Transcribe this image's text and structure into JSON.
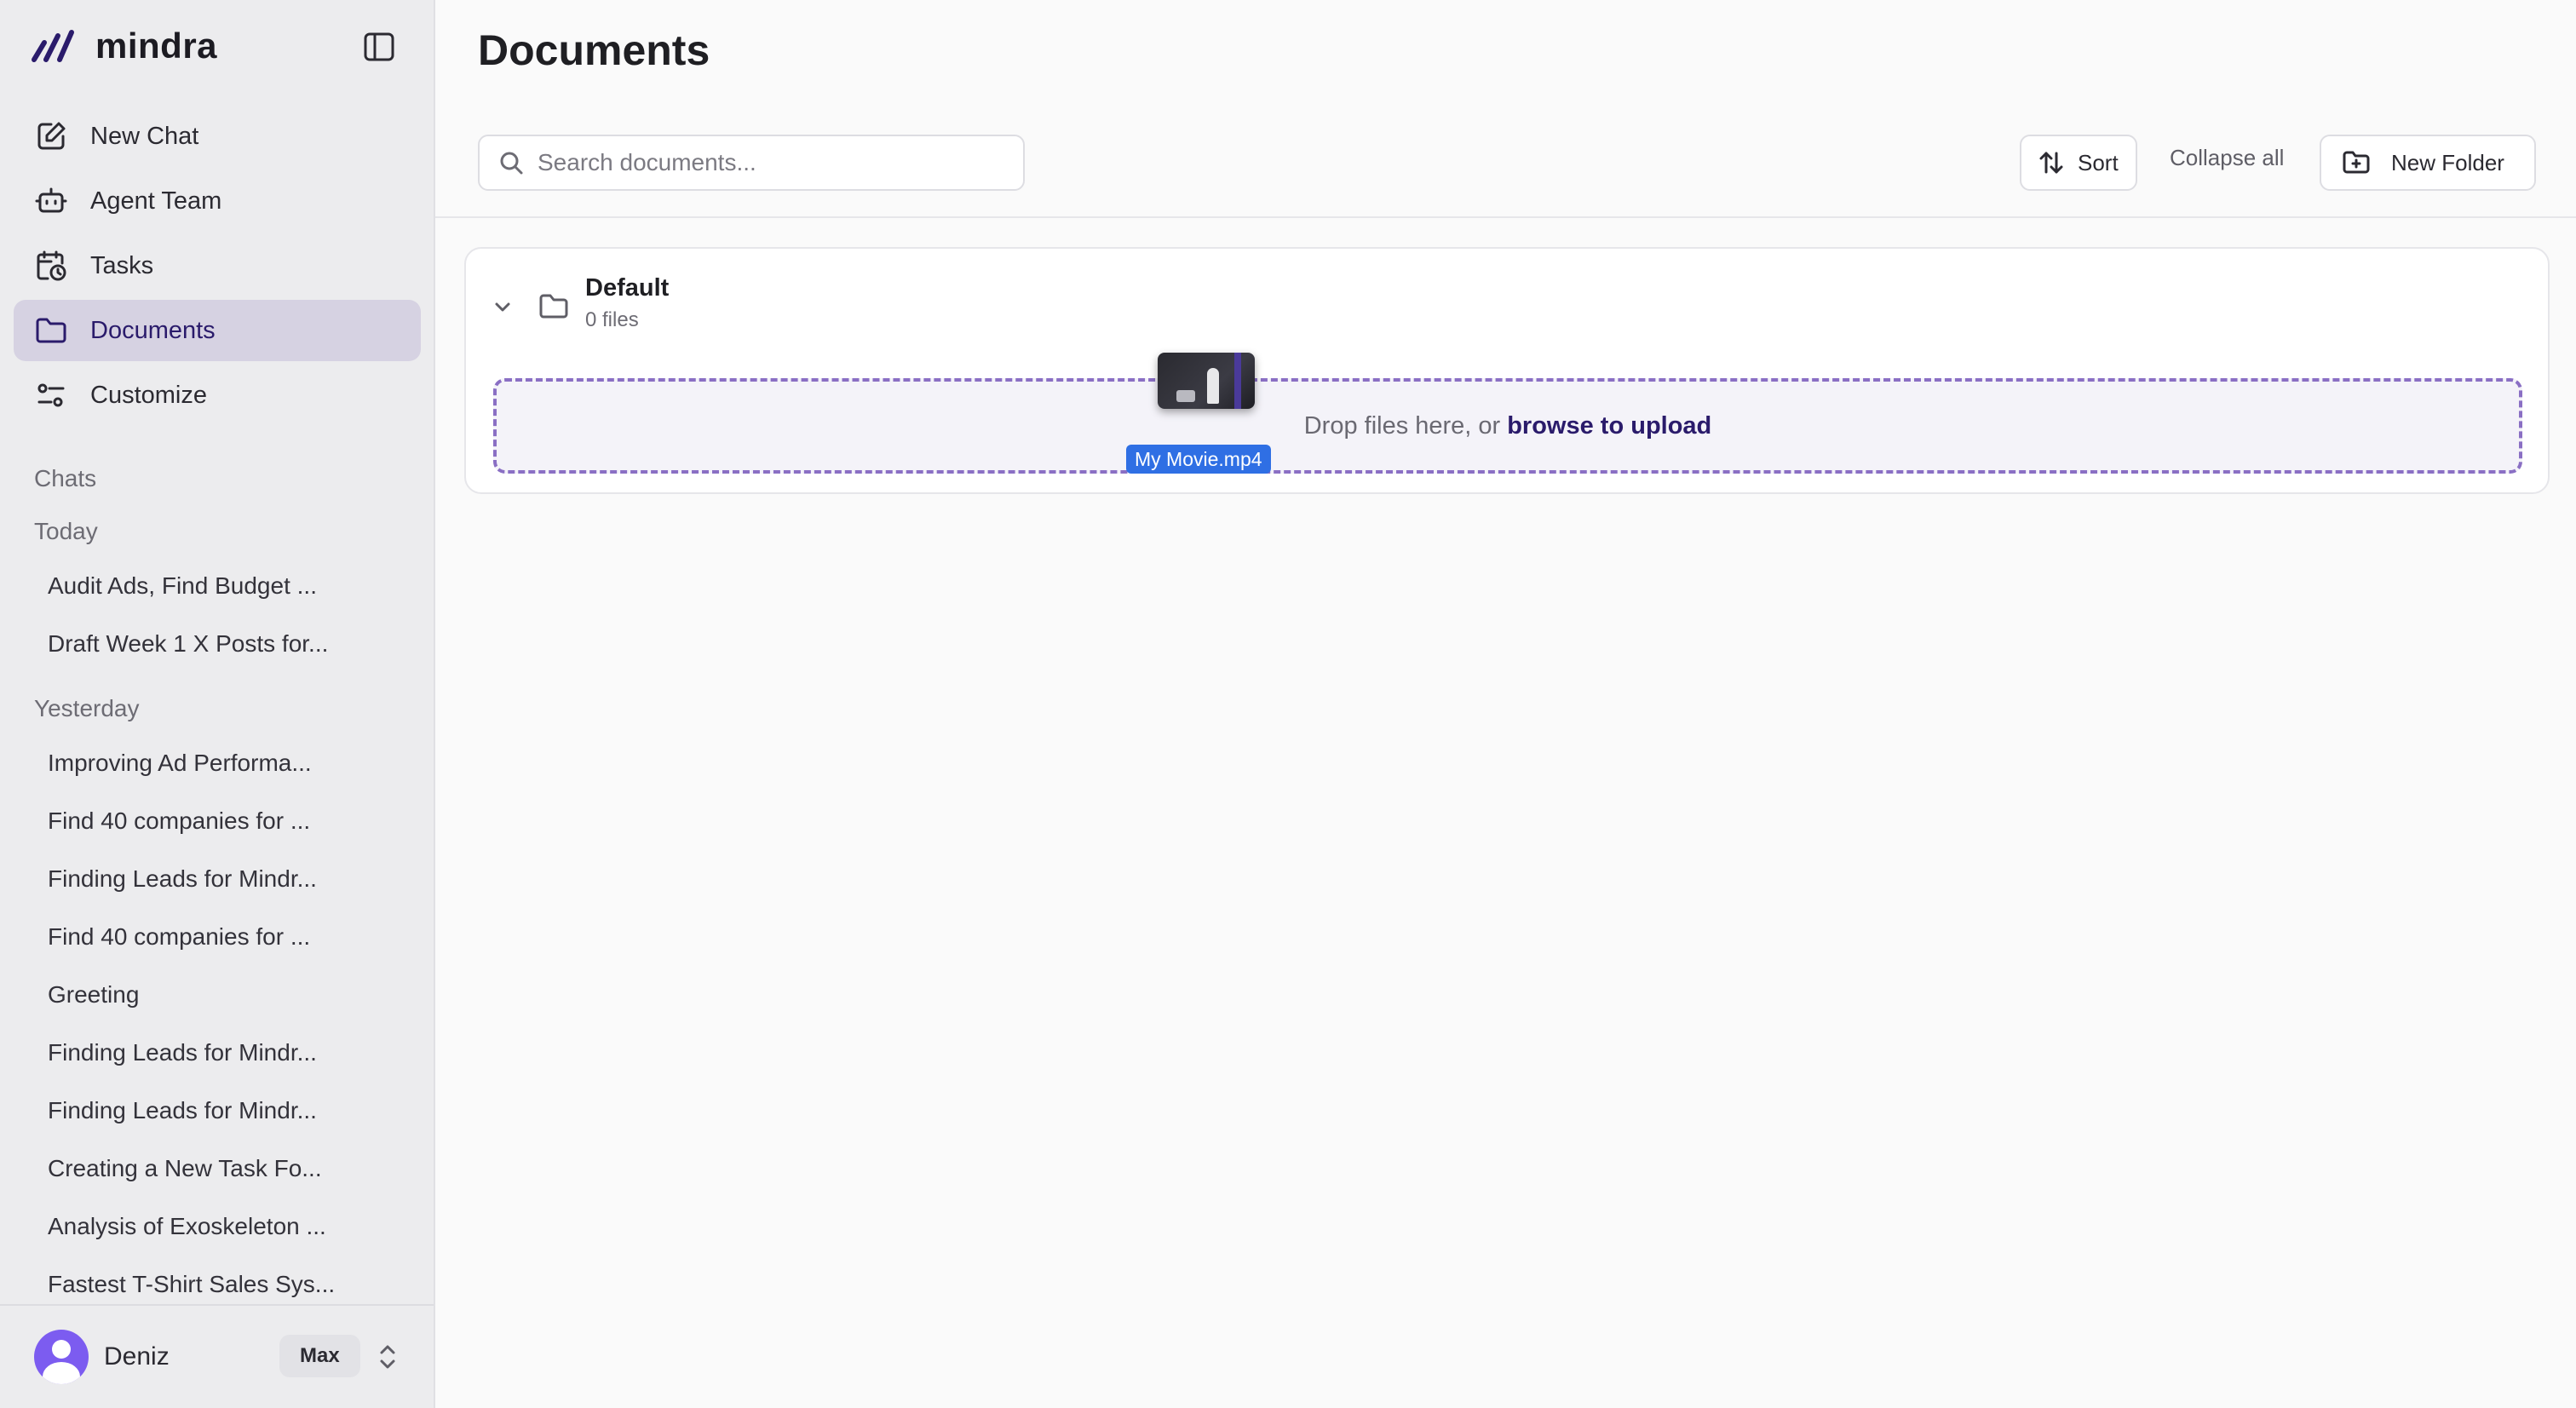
{
  "brand": {
    "name": "mindra",
    "accent": "#2a1b6b"
  },
  "nav": {
    "items": [
      {
        "label": "New Chat",
        "icon": "edit-icon"
      },
      {
        "label": "Agent Team",
        "icon": "robot-icon"
      },
      {
        "label": "Tasks",
        "icon": "calendar-clock-icon"
      },
      {
        "label": "Documents",
        "icon": "folder-icon",
        "active": true
      },
      {
        "label": "Customize",
        "icon": "sliders-icon"
      }
    ]
  },
  "chats": {
    "heading": "Chats",
    "today_label": "Today",
    "today": [
      "Audit Ads, Find Budget ...",
      "Draft Week 1 X Posts for..."
    ],
    "yesterday_label": "Yesterday",
    "yesterday": [
      "Improving Ad Performa...",
      "Find 40 companies for ...",
      "Finding Leads for Mindr...",
      "Find 40 companies for ...",
      "Greeting",
      "Finding Leads for Mindr...",
      "Finding Leads for Mindr...",
      "Creating a New Task Fo...",
      "Analysis of Exoskeleton ...",
      "Fastest T-Shirt Sales Sys..."
    ]
  },
  "user": {
    "name": "Deniz",
    "plan": "Max"
  },
  "main": {
    "title": "Documents",
    "search": {
      "placeholder": "Search documents...",
      "value": ""
    },
    "sort_label": "Sort",
    "collapse_label": "Collapse all",
    "new_folder_label": "New Folder"
  },
  "folder": {
    "name": "Default",
    "count": "0 files",
    "drop_text": "Drop files here, or",
    "browse_text": "browse to upload"
  },
  "drag": {
    "file_name": "My Movie.mp4"
  }
}
